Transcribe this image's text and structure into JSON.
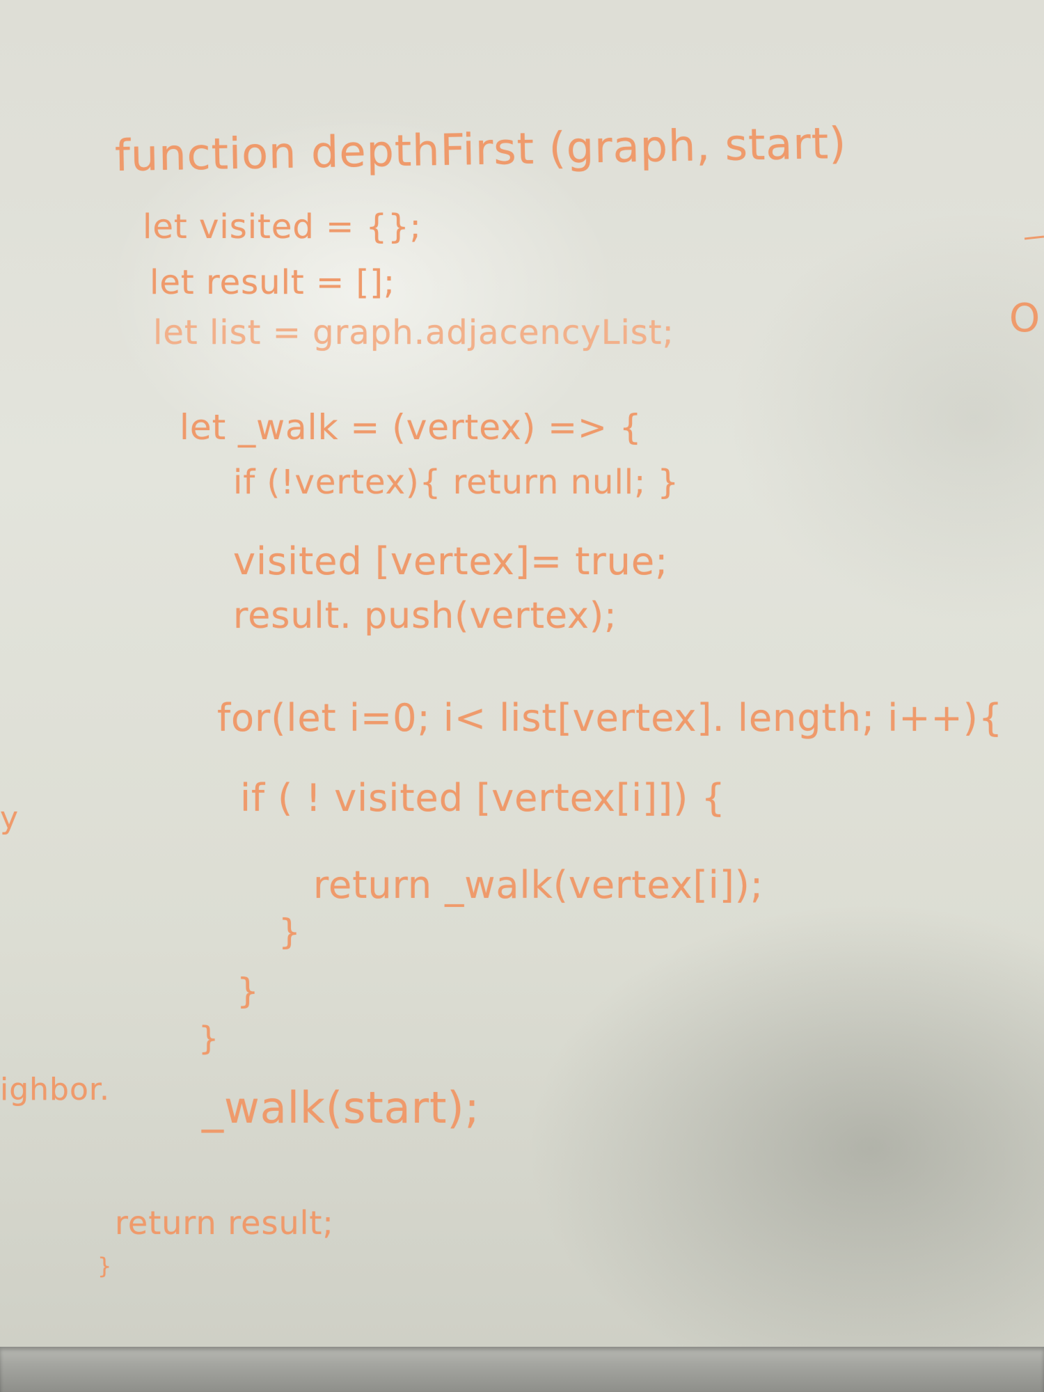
{
  "whiteboard": {
    "code_lines": [
      "function depthFirst (graph, start)",
      "let visited = {};",
      "let result = [];",
      "let list = graph.adjacencyList;",
      "let _walk = (vertex) => {",
      "if (!vertex){ return null; }",
      "visited [vertex]= true;",
      "result. push(vertex);",
      "for(let i=0; i< list[vertex]. length; i++){",
      "if ( ! visited [vertex[i]]) {",
      "return _walk(vertex[i]);",
      "}",
      "}",
      "}",
      "_walk(start);",
      "return result;",
      "}"
    ],
    "fragments": {
      "right_edge": "O",
      "left_edge_top": "y",
      "left_edge_bottom": "ighbor."
    },
    "ink_color": "#ef9a6b"
  }
}
